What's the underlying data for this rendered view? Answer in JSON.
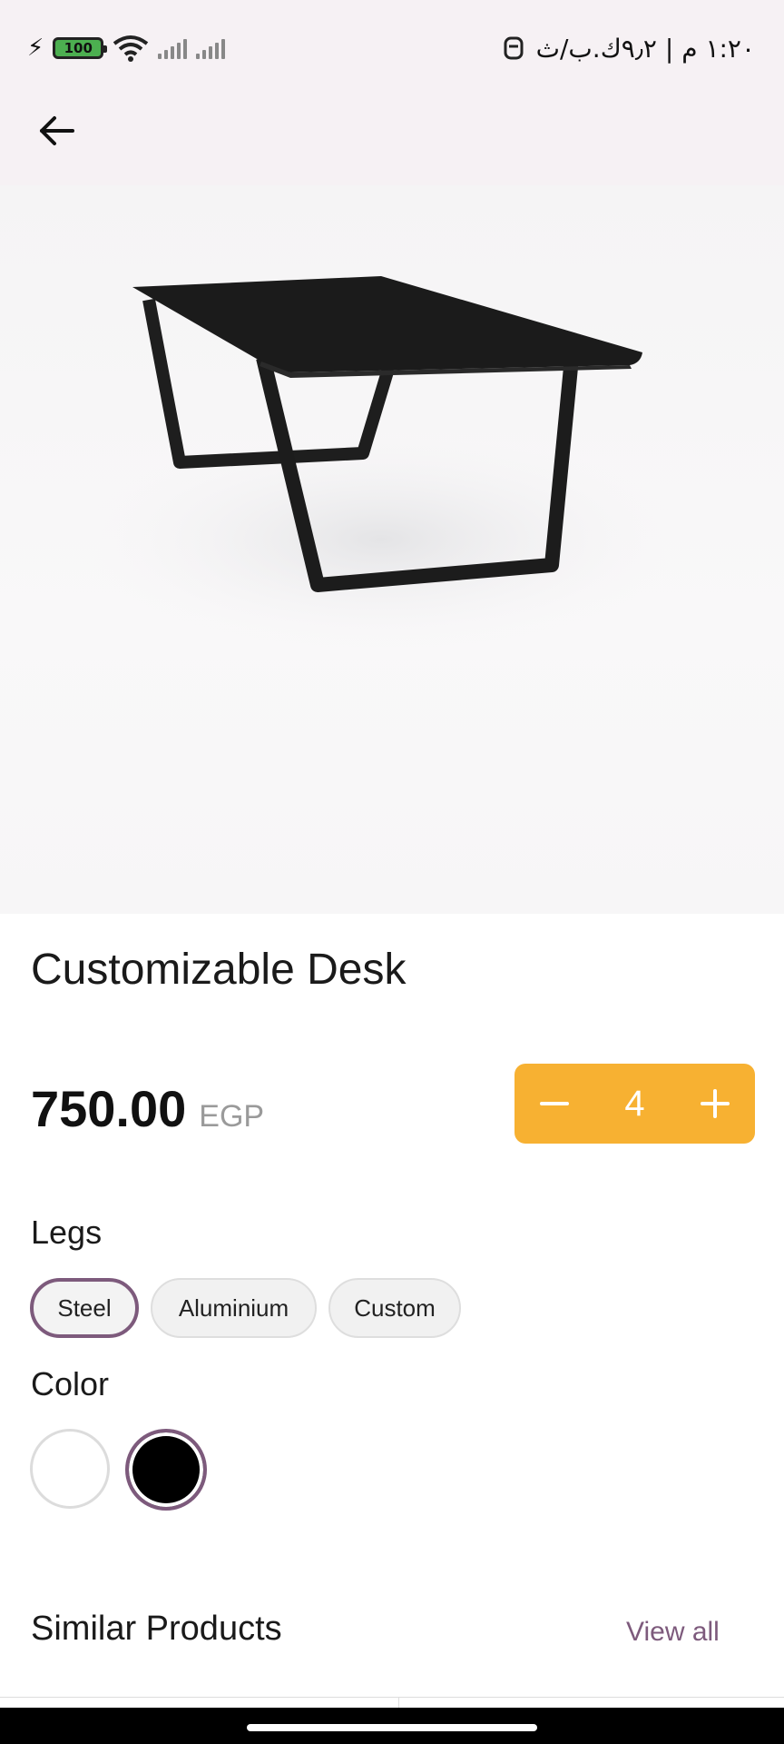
{
  "status_bar": {
    "battery": "100",
    "time_text": "١:٢٠ م | ٩٫٢ك.ب/ث"
  },
  "product": {
    "title": "Customizable Desk",
    "price": "750.00",
    "currency": "EGP",
    "quantity": "4"
  },
  "legs": {
    "label": "Legs",
    "options": [
      "Steel",
      "Aluminium",
      "Custom"
    ],
    "selected": "Steel"
  },
  "color": {
    "label": "Color",
    "options": [
      "#ffffff",
      "#000000"
    ],
    "selected": "#000000"
  },
  "similar": {
    "title": "Similar Products",
    "view_all": "View all"
  },
  "theme": {
    "accent": "#7d5a7c",
    "quantity_bg": "#f7b132"
  }
}
